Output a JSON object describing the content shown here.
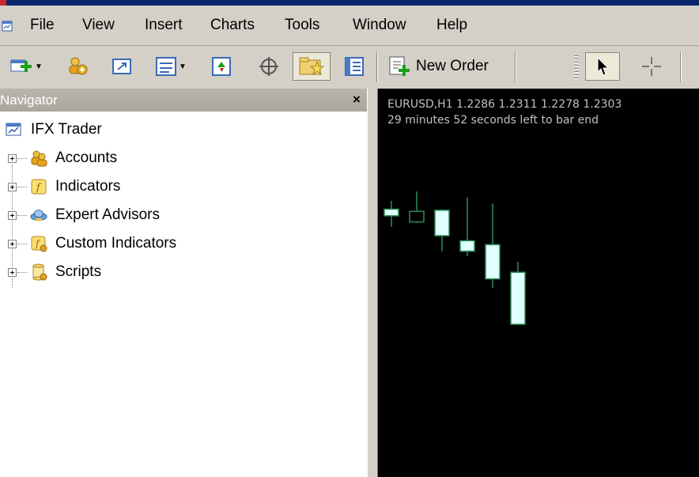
{
  "menu": {
    "icon": "app-chart-icon",
    "items": [
      "File",
      "View",
      "Insert",
      "Charts",
      "Tools",
      "Window",
      "Help"
    ]
  },
  "toolbar": {
    "new_order_label": "New Order",
    "icons": [
      "new-chart-icon",
      "profiles-icon",
      "maximize-chart-icon",
      "chart-window-icon",
      "market-watch-icon",
      "data-window-icon",
      "navigator-icon",
      "terminal-icon",
      "new-order-icon",
      "cursor-icon",
      "crosshair-icon"
    ]
  },
  "navigator": {
    "title": "Navigator",
    "close": "×",
    "root": "IFX Trader",
    "items": [
      {
        "label": "Accounts",
        "icon": "accounts-icon"
      },
      {
        "label": "Indicators",
        "icon": "indicators-icon"
      },
      {
        "label": "Expert Advisors",
        "icon": "expert-advisors-icon"
      },
      {
        "label": "Custom Indicators",
        "icon": "custom-indicators-icon"
      },
      {
        "label": "Scripts",
        "icon": "scripts-icon"
      }
    ]
  },
  "chart": {
    "info_line": "EURUSD,H1  1.2286 1.2311 1.2278 1.2303",
    "timer_line": "29 minutes 52 seconds left to bar end",
    "colors": {
      "background": "#000000",
      "candle_body": "#e0ffff",
      "wick": "#2e8b57",
      "text": "#c0c0c0"
    }
  },
  "chart_data": {
    "type": "candlestick",
    "symbol": "EURUSD",
    "timeframe": "H1",
    "candles": [
      {
        "open": 1.2308,
        "high": 1.2323,
        "low": 1.2276,
        "close": 1.2296,
        "direction": "bearish"
      },
      {
        "open": 1.2285,
        "high": 1.234,
        "low": 1.2283,
        "close": 1.2304,
        "direction": "bullish"
      },
      {
        "open": 1.2306,
        "high": 1.2308,
        "low": 1.2232,
        "close": 1.226,
        "direction": "bearish"
      },
      {
        "open": 1.2251,
        "high": 1.2329,
        "low": 1.2223,
        "close": 1.2232,
        "direction": "bearish"
      },
      {
        "open": 1.2244,
        "high": 1.2318,
        "low": 1.2166,
        "close": 1.2182,
        "direction": "bearish"
      },
      {
        "open": 1.2194,
        "high": 1.2213,
        "low": 1.21,
        "close": 1.21,
        "direction": "bearish"
      }
    ]
  }
}
